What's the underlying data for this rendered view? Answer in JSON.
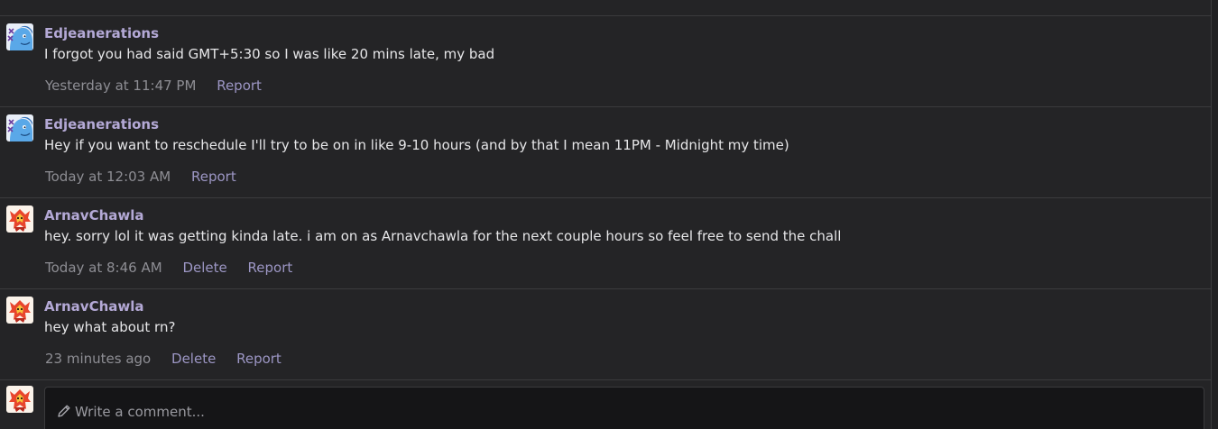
{
  "comments": [
    {
      "author": "Edjeanerations",
      "avatar": "blue-character-avatar",
      "text": "I forgot you had said GMT+5:30 so I was like 20 mins late, my bad",
      "time": "Yesterday at 11:47 PM",
      "report_label": "Report"
    },
    {
      "author": "Edjeanerations",
      "avatar": "blue-character-avatar",
      "text": "Hey if you want to reschedule I'll try to be on in like 9-10 hours (and by that I mean 11PM - Midnight my time)",
      "time": "Today at 12:03 AM",
      "report_label": "Report"
    },
    {
      "author": "ArnavChawla",
      "avatar": "fire-fox-avatar",
      "text": "hey. sorry lol it was getting kinda late. i am on as Arnavchawla for the next couple hours so feel free to send the chall",
      "time": "Today at 8:46 AM",
      "delete_label": "Delete",
      "report_label": "Report"
    },
    {
      "author": "ArnavChawla",
      "avatar": "fire-fox-avatar",
      "text": "hey what about rn?",
      "time": "23 minutes ago",
      "delete_label": "Delete",
      "report_label": "Report"
    }
  ],
  "composer": {
    "placeholder": "Write a comment...",
    "icon": "pencil-icon",
    "avatar": "fire-fox-avatar"
  },
  "colors": {
    "background": "#242426",
    "author": "#b4a9d6",
    "body_text": "#e6e6e8",
    "timestamp": "#8e8e94",
    "action_link": "#9c96c4",
    "composer_bg": "#151517"
  }
}
